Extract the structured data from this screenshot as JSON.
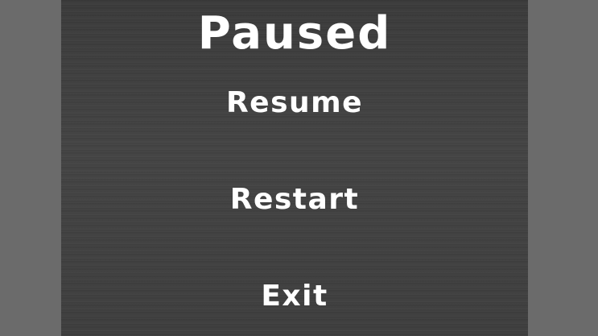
{
  "pause_menu": {
    "title": "Paused",
    "items": [
      {
        "label": "Resume"
      },
      {
        "label": "Restart"
      },
      {
        "label": "Exit"
      }
    ]
  },
  "colors": {
    "background": "#6b6b6b",
    "panel": "#3f3f3f",
    "text": "#ffffff"
  }
}
